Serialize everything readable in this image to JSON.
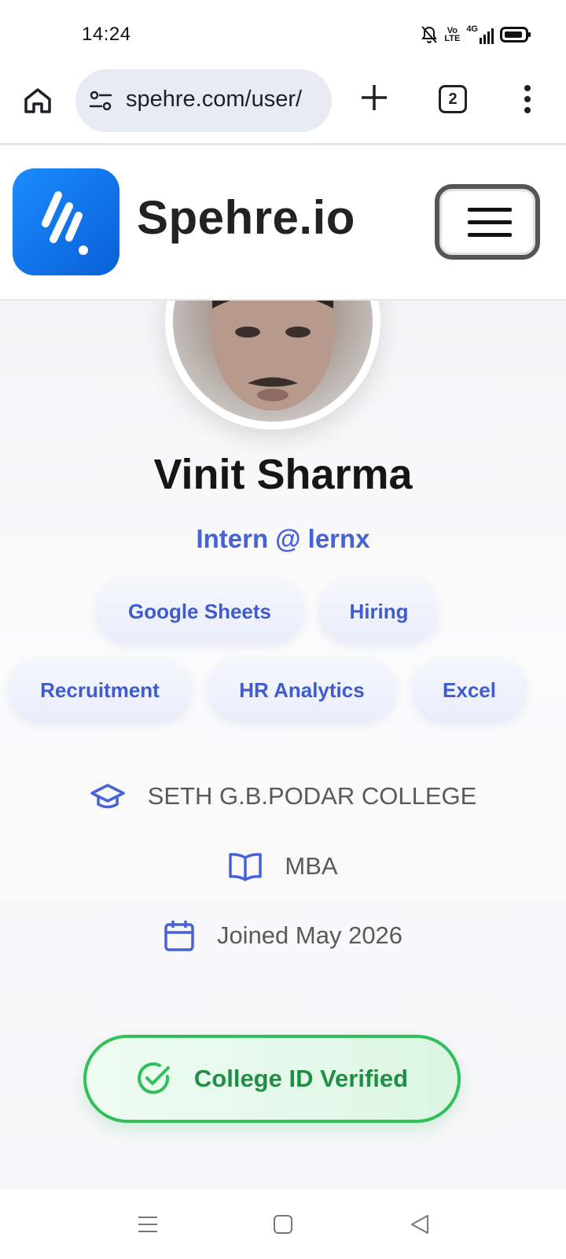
{
  "status_bar": {
    "time": "14:24",
    "network_label": "4G",
    "volte_label": "Vo LTE",
    "icons": [
      "bell-off-icon",
      "volte-icon",
      "signal-icon",
      "battery-icon"
    ]
  },
  "browser": {
    "url": "spehre.com/user/",
    "tab_count": "2",
    "icons": [
      "home-icon",
      "site-settings-icon",
      "new-tab-icon",
      "tabs-icon",
      "more-icon"
    ]
  },
  "site_header": {
    "brand": "Spehre.io",
    "brand_color": "#1a8cff",
    "menu_icon": "hamburger-icon"
  },
  "profile": {
    "name": "Vinit Sharma",
    "role": "Intern @ lernx",
    "skills": [
      "Google Sheets",
      "Hiring",
      "Recruitment",
      "HR Analytics",
      "Excel"
    ],
    "college": "SETH G.B.PODAR COLLEGE",
    "degree": "MBA",
    "joined": "Joined May 2026",
    "verified_label": "College ID Verified",
    "accent_color": "#4563d6",
    "verified_color": "#2fbf5b"
  },
  "nav_bar": {
    "icons": [
      "recents-icon",
      "home-square-icon",
      "back-icon"
    ]
  }
}
